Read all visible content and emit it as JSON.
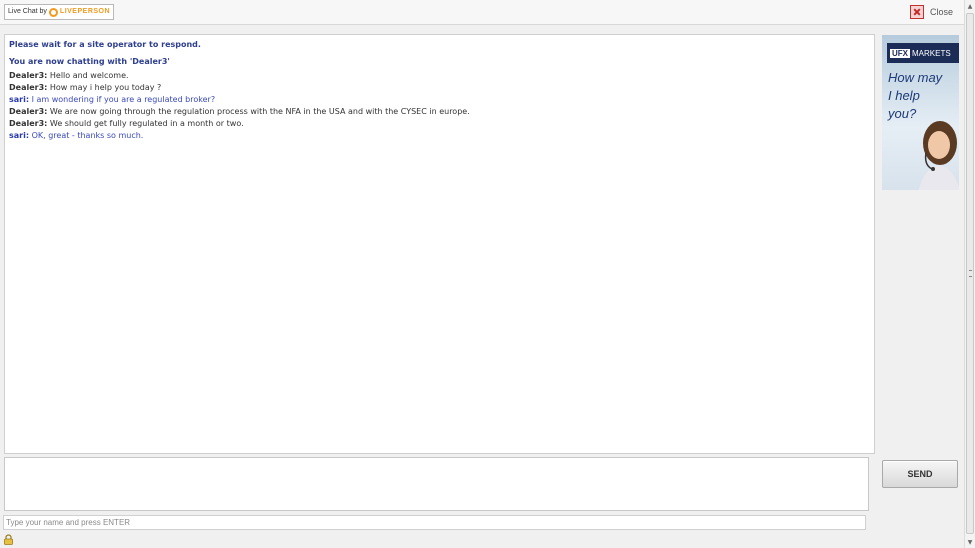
{
  "header": {
    "brand_prefix": "Live Chat by",
    "brand_name": "LIVEPERSON",
    "close_label": "Close"
  },
  "transcript": {
    "system_messages": [
      "Please wait for a site operator to respond.",
      "You are now chatting with 'Dealer3'"
    ],
    "messages": [
      {
        "sender": "Dealer3:",
        "text": "Hello and welcome.",
        "role": "operator"
      },
      {
        "sender": "Dealer3:",
        "text": "How may i help you today ?",
        "role": "operator"
      },
      {
        "sender": "sari:",
        "text": "I am wondering if you are a regulated broker?",
        "role": "visitor"
      },
      {
        "sender": "Dealer3:",
        "text": "We are now going through the regulation process with the NFA in the USA and with the CYSEC in europe.",
        "role": "operator"
      },
      {
        "sender": "Dealer3:",
        "text": "We should get fully regulated in a month or two.",
        "role": "operator"
      },
      {
        "sender": "sari:",
        "text": "OK, great - thanks so much.",
        "role": "visitor"
      }
    ]
  },
  "ad": {
    "logo_box": "UFX",
    "logo_text": "MARKETS",
    "tagline_lines": [
      "How may",
      "I help",
      "you?"
    ]
  },
  "composer": {
    "message_value": "",
    "send_label": "SEND",
    "name_placeholder": "Type your name and press ENTER"
  },
  "colors": {
    "system_text": "#2f3f8f",
    "visitor_text": "#3a4ab8",
    "brand_orange": "#f29a1d",
    "ad_navy": "#1b2c57"
  },
  "icons": [
    "liveperson-logo-icon",
    "close-icon",
    "lock-icon",
    "scroll-up-icon",
    "scroll-down-icon"
  ]
}
